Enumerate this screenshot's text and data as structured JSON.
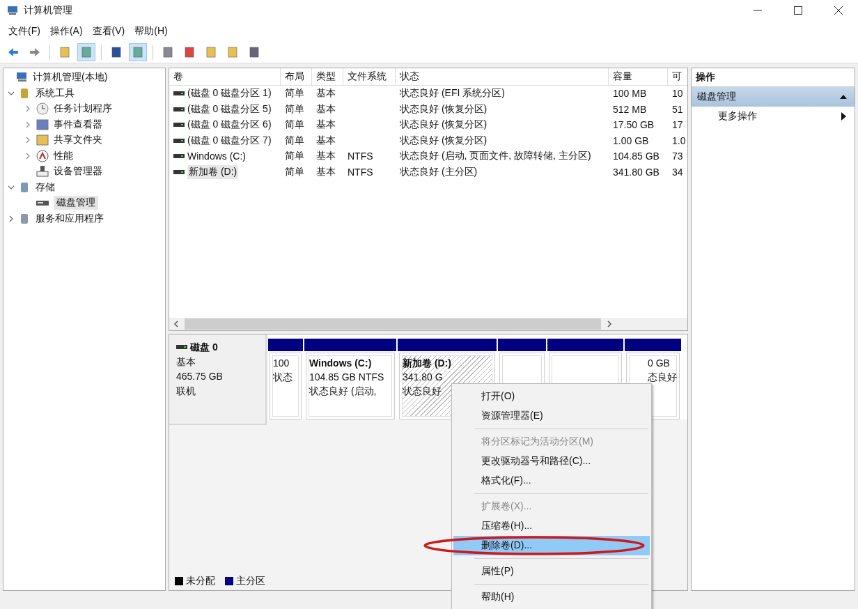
{
  "window": {
    "title": "计算机管理"
  },
  "menu_bar": [
    "文件(F)",
    "操作(A)",
    "查看(V)",
    "帮助(H)"
  ],
  "toolbar": [
    {
      "pressed": false
    },
    {
      "pressed": false
    },
    {
      "pressed": false
    },
    {
      "pressed": true
    },
    {
      "pressed": false
    },
    {
      "pressed": true
    },
    {
      "pressed": false
    },
    {
      "pressed": false
    },
    {
      "pressed": false
    },
    {
      "pressed": false
    },
    {
      "pressed": false
    }
  ],
  "tree": [
    {
      "label": "计算机管理(本地)",
      "children": [
        {
          "label": "系统工具",
          "expanded": true,
          "children": [
            {
              "label": "任务计划程序",
              "expanded": false,
              "selected": false
            },
            {
              "label": "事件查看器",
              "expanded": false,
              "selected": false
            },
            {
              "label": "共享文件夹",
              "expanded": false,
              "selected": false
            },
            {
              "label": "性能",
              "expanded": false,
              "selected": false
            },
            {
              "label": "设备管理器",
              "selected": false
            }
          ]
        },
        {
          "label": "存储",
          "expanded": true,
          "children": [
            {
              "label": "磁盘管理",
              "selected": true
            }
          ]
        },
        {
          "label": "服务和应用程序",
          "expanded": false
        }
      ]
    }
  ],
  "volume_table": {
    "columns": [
      "卷",
      "布局",
      "类型",
      "文件系统",
      "状态",
      "容量",
      "可"
    ],
    "rows": [
      {
        "volume": "(磁盘 0 磁盘分区 1)",
        "layout": "简单",
        "type": "基本",
        "status": "状态良好 (EFI 系统分区)",
        "capacity": "100 MB",
        "column_7": "10",
        "selected": false
      },
      {
        "volume": "(磁盘 0 磁盘分区 5)",
        "layout": "简单",
        "type": "基本",
        "status": "状态良好 (恢复分区)",
        "capacity": "512 MB",
        "column_7": "51",
        "selected": false
      },
      {
        "volume": "(磁盘 0 磁盘分区 6)",
        "layout": "简单",
        "type": "基本",
        "status": "状态良好 (恢复分区)",
        "capacity": "17.50 GB",
        "column_7": "17",
        "selected": false
      },
      {
        "volume": "(磁盘 0 磁盘分区 7)",
        "layout": "简单",
        "type": "基本",
        "status": "状态良好 (恢复分区)",
        "capacity": "1.00 GB",
        "column_7": "1.0",
        "selected": false
      },
      {
        "volume": "Windows (C:)",
        "layout": "简单",
        "type": "基本",
        "file_system": "NTFS",
        "status": "状态良好 (启动, 页面文件, 故障转储, 主分区)",
        "capacity": "104.85 GB",
        "column_7": "73",
        "selected": false
      },
      {
        "volume": "新加卷 (D:)",
        "layout": "简单",
        "type": "基本",
        "file_system": "NTFS",
        "status": "状态良好 (主分区)",
        "capacity": "341.80 GB",
        "column_7": "34",
        "selected": true
      }
    ]
  },
  "disk": {
    "name": "磁盘 0",
    "type": "基本",
    "size": "465.75 GB",
    "state": "联机",
    "partitions": [
      {
        "lines": [
          "100",
          "状态"
        ],
        "selected": false
      },
      {
        "title": "Windows  (C:)",
        "lines": [
          "104.85 GB NTFS",
          "状态良好 (启动,"
        ],
        "selected": false
      },
      {
        "title": "新加卷  (D:)",
        "lines": [
          "341.80 G",
          "状态良好"
        ],
        "selected": true
      },
      {
        "selected": false
      },
      {
        "selected": false
      },
      {
        "lines": [
          "0 GB",
          "态良好"
        ],
        "selected": false
      }
    ]
  },
  "legend": [
    {
      "label": "未分配",
      "color": "#000000"
    },
    {
      "label": "主分区",
      "color": "#000080"
    }
  ],
  "actions": {
    "title": "操作",
    "section": {
      "label": "磁盘管理",
      "expanded": true
    },
    "items": [
      "更多操作"
    ]
  },
  "context_menu": [
    {
      "kind": "item",
      "label": "打开(O)",
      "disabled": false,
      "selected": false,
      "circled": false
    },
    {
      "kind": "item",
      "label": "资源管理器(E)",
      "disabled": false,
      "selected": false,
      "circled": false
    },
    {
      "kind": "separator"
    },
    {
      "kind": "item",
      "label": "将分区标记为活动分区(M)",
      "disabled": true,
      "selected": false,
      "circled": false
    },
    {
      "kind": "item",
      "label": "更改驱动器号和路径(C)...",
      "disabled": false,
      "selected": false,
      "circled": false
    },
    {
      "kind": "item",
      "label": "格式化(F)...",
      "disabled": false,
      "selected": false,
      "circled": false
    },
    {
      "kind": "separator"
    },
    {
      "kind": "item",
      "label": "扩展卷(X)...",
      "disabled": true,
      "selected": false,
      "circled": false
    },
    {
      "kind": "item",
      "label": "压缩卷(H)...",
      "disabled": false,
      "selected": false,
      "circled": false
    },
    {
      "kind": "item",
      "label": "删除卷(D)...",
      "disabled": false,
      "selected": true,
      "circled": true
    },
    {
      "kind": "separator"
    },
    {
      "kind": "item",
      "label": "属性(P)",
      "disabled": false,
      "selected": false,
      "circled": false
    },
    {
      "kind": "separator"
    },
    {
      "kind": "item",
      "label": "帮助(H)",
      "disabled": false,
      "selected": false,
      "circled": false
    }
  ]
}
